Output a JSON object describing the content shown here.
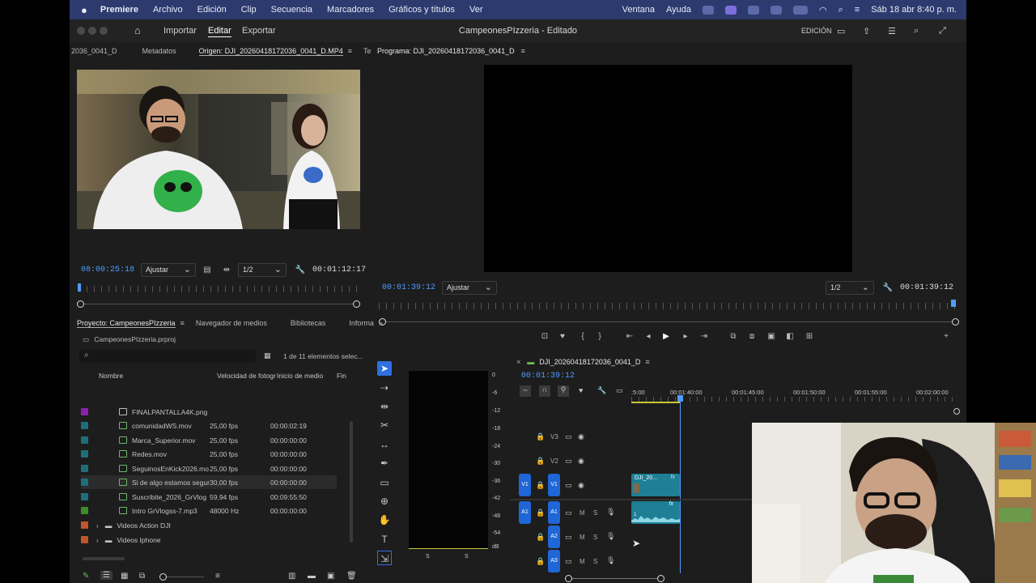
{
  "menubar": {
    "app": "Premiere",
    "items": [
      "Archivo",
      "Edición",
      "Clip",
      "Secuencia",
      "Marcadores",
      "Gráficos y títulos",
      "Ver",
      "Ventana",
      "Ayuda"
    ],
    "datetime": "Sáb 18 abr 8:40 p. m."
  },
  "titlebar": {
    "tabs": {
      "import": "Importar",
      "edit": "Editar",
      "export": "Exportar"
    },
    "project_title": "CampeonesPIzzeria - Editado",
    "workspace": "EDICIÓN"
  },
  "source": {
    "tabs": [
      "2036_0041_D",
      "Metadatos",
      "Origen: DJI_20260418172036_0041_D.MP4",
      "Text"
    ],
    "timecode_in": "08:00:25:18",
    "fit": "Ajustar",
    "resolution": "1/2",
    "timecode_dur": "00:01:12:17"
  },
  "program": {
    "tab": "Programa: DJI_20260418172036_0041_D",
    "timecode_in": "00:01:39:12",
    "fit": "Ajustar",
    "resolution": "1/2",
    "timecode_dur": "00:01:39:12"
  },
  "project": {
    "tabs": [
      "Proyecto: CampeonesPIzzeria",
      "Navegador de medios",
      "Bibliotecas",
      "Informa"
    ],
    "file": "CampeonesPIzzeria.prproj",
    "count": "1 de 11 elementos selec...",
    "columns": {
      "name": "Nombre",
      "fps": "Velocidad de fotogr",
      "start": "Inicio de medio",
      "end": "Fin"
    },
    "rows": [
      {
        "name": "FINALPANTALLA4K.png",
        "fps": "",
        "start": "",
        "color": "#8c1fb0"
      },
      {
        "name": "comunidadWS.mov",
        "fps": "25,00 fps",
        "start": "00:00:02:19",
        "color": "#1e6f7a"
      },
      {
        "name": "Marca_Superior.mov",
        "fps": "25,00 fps",
        "start": "00:00:00:00",
        "color": "#1e6f7a"
      },
      {
        "name": "Redes.mov",
        "fps": "25,00 fps",
        "start": "00:00:00:00",
        "color": "#1e6f7a"
      },
      {
        "name": "SeguinosEnKick2026.mo",
        "fps": "25,00 fps",
        "start": "00:00:00:00",
        "color": "#1e6f7a"
      },
      {
        "name": "Si de algo estamos segur",
        "fps": "30,00 fps",
        "start": "00:00:00:00",
        "color": "#1e6f7a"
      },
      {
        "name": "Suscribite_2026_GrVlog",
        "fps": "59,94 fps",
        "start": "00:09:55:50",
        "color": "#1e6f7a"
      },
      {
        "name": "Intro GrVlogss-7.mp3",
        "fps": "48000 Hz",
        "start": "00:00:00:00",
        "color": "#3c8c2a"
      }
    ],
    "folders": [
      {
        "name": "Videos Action DJI",
        "color": "#c0562a"
      },
      {
        "name": "Videos Iphone",
        "color": "#c0562a"
      }
    ]
  },
  "meter": {
    "scale": [
      "0",
      "-6",
      "-12",
      "-18",
      "-24",
      "-30",
      "-36",
      "-42",
      "-48",
      "-54",
      "dB"
    ],
    "solo": [
      "S",
      "S"
    ]
  },
  "timeline": {
    "sequence": "DJI_20260418172036_0041_D",
    "timecode": "00:01:39:12",
    "ruler": [
      ":5:00",
      "00:01:40:00",
      "00:01:45:00",
      "00:01:50:00",
      "00:01:55:00",
      "00:02:00:00"
    ],
    "tracks_video": [
      "V3",
      "V2",
      "V1"
    ],
    "tracks_audio": [
      "A1",
      "A2",
      "A3"
    ],
    "source_patch_v": "V1",
    "source_patch_a": "A1",
    "clip_label": "DJI_20...",
    "fx": "fx",
    "audio_clip_label": "1",
    "mute": "M",
    "solo": "S"
  },
  "colors": {
    "accent": "#2f6fe0",
    "timecode": "#4f9bff",
    "clip": "#1e7f95"
  }
}
